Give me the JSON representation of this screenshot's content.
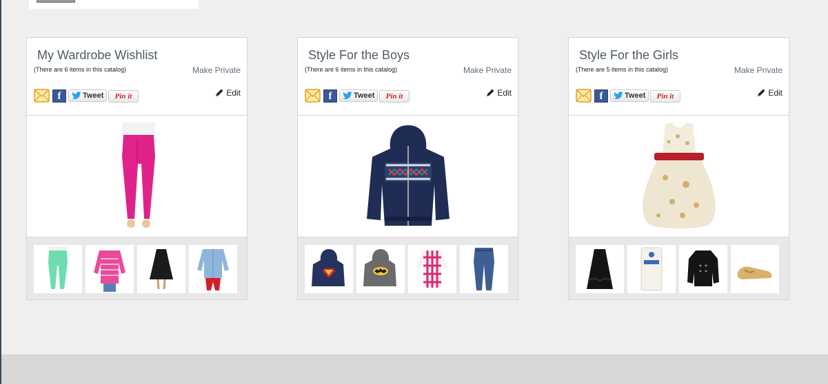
{
  "catalogs": [
    {
      "title": "My Wardrobe Wishlist",
      "count_text": "(There are 6 items in this catalog)",
      "privacy_label": "Make Private",
      "edit_label": "Edit",
      "share": {
        "tweet_label": "Tweet",
        "pin_label": "Pin it"
      },
      "main_item": "pink-skinny-jeans",
      "thumbnails": [
        "mint-jeans",
        "pink-striped-top",
        "black-dress",
        "denim-shirt-red-pants"
      ]
    },
    {
      "title": "Style For the Boys",
      "count_text": "(There are 6 items in this catalog)",
      "privacy_label": "Make Private",
      "edit_label": "Edit",
      "share": {
        "tweet_label": "Tweet",
        "pin_label": "Pin it"
      },
      "main_item": "navy-fair-isle-hoodie",
      "thumbnails": [
        "superman-hoodie",
        "batman-hoodie",
        "pink-plaid-shirt",
        "boys-jeans"
      ]
    },
    {
      "title": "Style For the Girls",
      "count_text": "(There are 5 items in this catalog)",
      "privacy_label": "Make Private",
      "edit_label": "Edit",
      "share": {
        "tweet_label": "Tweet",
        "pin_label": "Pin it"
      },
      "main_item": "gold-floral-dress-red-sash",
      "thumbnails": [
        "black-ruffle-dress",
        "white-tights-pack",
        "black-peacoat",
        "gold-ballet-flats"
      ]
    }
  ],
  "colors": {
    "page_bg": "#efefef",
    "title_text": "#4e5a68",
    "link_text": "#5f6d7d",
    "facebook": "#3b5998",
    "pinterest": "#cb2027",
    "twitter": "#2aa3ef"
  }
}
